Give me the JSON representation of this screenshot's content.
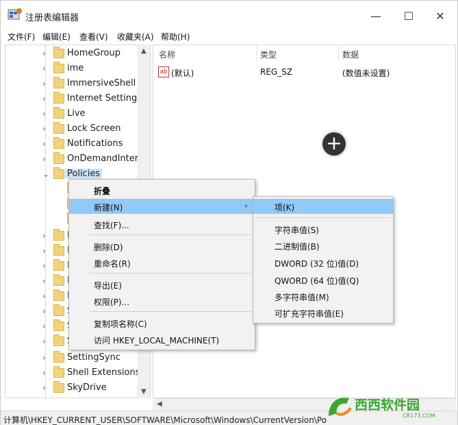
{
  "window": {
    "title": "注册表编辑器",
    "minimize_glyph": "—",
    "maximize_glyph": "☐",
    "close_glyph": "✕"
  },
  "menubar": {
    "items": [
      "文件(F)",
      "编辑(E)",
      "查看(V)",
      "收藏夹(A)",
      "帮助(H)"
    ]
  },
  "tree": {
    "items": [
      {
        "label": "HomeGroup",
        "chevron": "›"
      },
      {
        "label": "ime",
        "chevron": "›"
      },
      {
        "label": "ImmersiveShell",
        "chevron": "›"
      },
      {
        "label": "Internet Settings",
        "chevron": "›"
      },
      {
        "label": "Live",
        "chevron": "›"
      },
      {
        "label": "Lock Screen",
        "chevron": "›"
      },
      {
        "label": "Notifications",
        "chevron": "›"
      },
      {
        "label": "OnDemandInterfac",
        "chevron": "›"
      },
      {
        "label": "Policies",
        "chevron": "⌄"
      },
      {
        "label": "P",
        "chevron": "›"
      },
      {
        "label": "P",
        "chevron": "›"
      },
      {
        "label": "R",
        "chevron": "›"
      },
      {
        "label": "R",
        "chevron": "›"
      },
      {
        "label": "R",
        "chevron": "›"
      },
      {
        "label": "S",
        "chevron": "›"
      },
      {
        "label": "S",
        "chevron": "›"
      },
      {
        "label": "S",
        "chevron": "›"
      },
      {
        "label": "SettingSync",
        "chevron": "›"
      },
      {
        "label": "Shell Extensions",
        "chevron": "›"
      },
      {
        "label": "SkyDrive",
        "chevron": "›"
      }
    ],
    "selected": "Policies"
  },
  "columns": {
    "name": "名称",
    "type": "类型",
    "data": "数据"
  },
  "values": [
    {
      "icon": "ab",
      "name": "(默认)",
      "type": "REG_SZ",
      "data": "(数值未设置)"
    }
  ],
  "context_menu": {
    "items": [
      {
        "label": "折叠",
        "bold": true
      },
      {
        "label": "新建(N)",
        "submenu_arrow": "›",
        "highlighted": true
      },
      {
        "label": "查找(F)..."
      },
      {
        "label": "删除(D)"
      },
      {
        "label": "重命名(R)"
      },
      {
        "label": "导出(E)"
      },
      {
        "label": "权限(P)..."
      },
      {
        "label": "复制项名称(C)"
      },
      {
        "label": "访问 HKEY_LOCAL_MACHINE(T)"
      }
    ]
  },
  "submenu": {
    "items": [
      {
        "label": "项(K)",
        "highlighted": true
      },
      {
        "label": "字符串值(S)"
      },
      {
        "label": "二进制值(B)"
      },
      {
        "label": "DWORD (32 位)值(D)"
      },
      {
        "label": "QWORD (64 位)值(Q)"
      },
      {
        "label": "多字符串值(M)"
      },
      {
        "label": "可扩充字符串值(E)"
      }
    ]
  },
  "statusbar": {
    "path": "计算机\\HKEY_CURRENT_USER\\SOFTWARE\\Microsoft\\Windows\\CurrentVersion\\Po"
  },
  "watermark": {
    "brand": "西西软件园",
    "domain": "CR173.COM"
  },
  "colors": {
    "highlight": "#91c9f7",
    "selection": "#cce4f7",
    "folder": "#f4d47a",
    "watermark_green": "#3aa82e",
    "watermark_orange": "#f08a1c"
  }
}
